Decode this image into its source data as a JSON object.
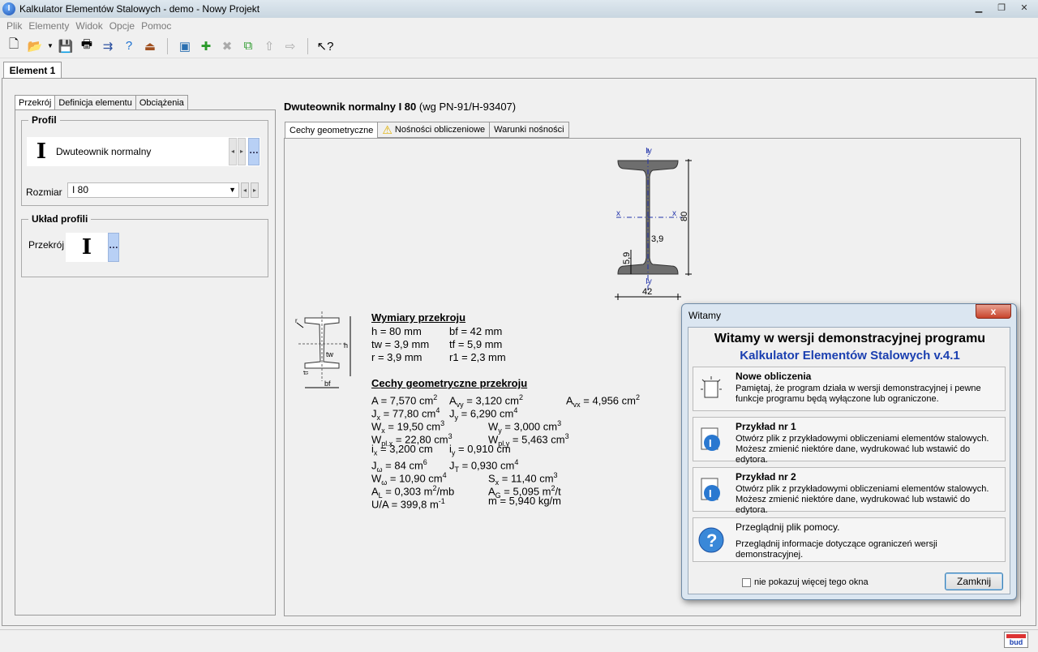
{
  "window": {
    "title": "Kalkulator Elementów Stalowych - demo - Nowy Projekt",
    "app_icon_letter": "I"
  },
  "menu": [
    "Plik",
    "Elementy",
    "Widok",
    "Opcje",
    "Pomoc"
  ],
  "doc_tab": "Element 1",
  "left_tabs": [
    "Przekrój",
    "Definicja elementu",
    "Obciążenia"
  ],
  "profil": {
    "group_title": "Profil",
    "name": "Dwuteownik normalny",
    "size_label": "Rozmiar",
    "size_value": "I 80"
  },
  "uklad": {
    "group_title": "Układ profili",
    "label": "Przekrój"
  },
  "section": {
    "title": "Dwuteownik normalny I 80",
    "norm": "(wg PN-91/H-93407)"
  },
  "right_tabs": [
    "Cechy geometryczne",
    "Nośności obliczeniowe",
    "Warunki nośności"
  ],
  "drawing": {
    "iy": "Iy",
    "x": "x",
    "h": "80",
    "b": "42",
    "tw": "3,9",
    "tf": "5,9",
    "small_h": "h",
    "small_tw": "tw",
    "small_bf": "bf",
    "small_tf": "tf",
    "small_r": "r"
  },
  "dims": {
    "header": "Wymiary przekroju",
    "h": "h = 80 mm",
    "bf": "bf = 42 mm",
    "tw": "tw = 3,9 mm",
    "tf": "tf = 5,9 mm",
    "r": "r = 3,9 mm",
    "r1": "r1 = 2,3 mm"
  },
  "geom": {
    "header": "Cechy geometryczne przekroju",
    "A": "7,570",
    "Avy": "3,120",
    "Avx": "4,956",
    "Jx": "77,80",
    "Jy": "6,290",
    "Wx": "19,50",
    "Wy": "3,000",
    "Wplx": "22,80",
    "Wply": "5,463",
    "ix": "3,200",
    "iy": "0,910",
    "Jw": "84",
    "JT": "0,930",
    "Ww": "10,90",
    "Sx": "11,40",
    "AL": "0,303",
    "AG": "5,095",
    "UA": "399,8",
    "m": "5,940"
  },
  "dialog": {
    "title": "Witamy",
    "close": "x",
    "heading": "Witamy w wersji demonstracyjnej programu",
    "subheading": "Kalkulator Elementów Stalowych  v.4.1",
    "items": [
      {
        "title": "Nowe obliczenia",
        "desc": "Pamiętaj, że program działa w wersji demonstracyjnej i pewne funkcje programu będą wyłączone lub ograniczone."
      },
      {
        "title": "Przykład nr 1",
        "desc": "Otwórz plik z przykładowymi obliczeniami elementów stalowych. Możesz zmienić niektóre dane, wydrukować lub wstawić do edytora."
      },
      {
        "title": "Przykład nr 2",
        "desc": "Otwórz plik z przykładowymi obliczeniami elementów stalowych. Możesz zmienić niektóre dane, wydrukować lub wstawić do edytora."
      },
      {
        "title": "Przeglądnij plik pomocy.",
        "desc": "Przeglądnij informacje dotyczące ograniczeń wersji demonstracyjnej."
      }
    ],
    "checkbox_label": "nie pokazuj więcej tego okna",
    "button": "Zamknij"
  },
  "status": {
    "logo_text": "bud"
  },
  "colors": {
    "accent_blue": "#1a3fb0",
    "dialog_bg": "#dbe6f1"
  }
}
